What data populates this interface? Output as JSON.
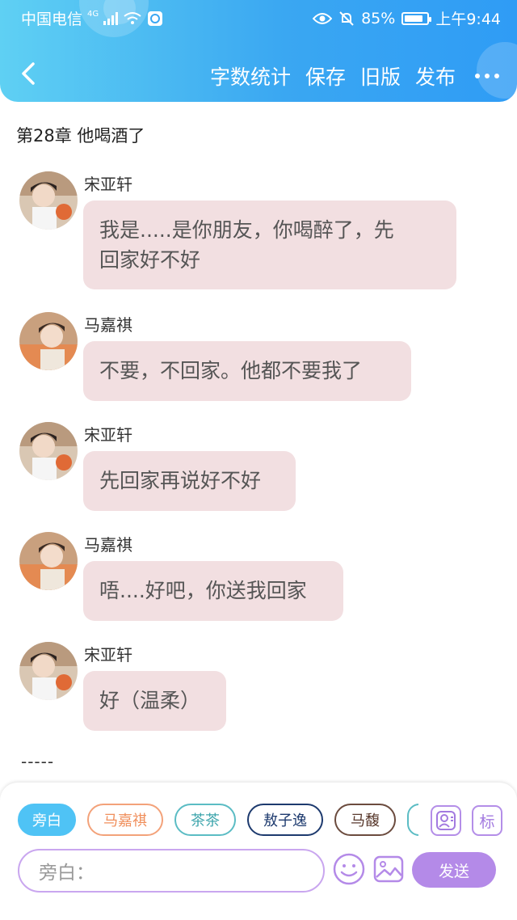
{
  "status_bar": {
    "carrier": "中国电信",
    "network": "4G",
    "battery": "85%",
    "battery_fraction": 0.85,
    "time": "上午9:44"
  },
  "nav": {
    "back_icon": "chevron-left-icon",
    "word_count": "字数统计",
    "save": "保存",
    "old_version": "旧版",
    "publish": "发布",
    "more_icon": "more-dots-icon"
  },
  "chapter_title": "第28章 他喝酒了",
  "messages": [
    {
      "speaker": "宋亚轩",
      "lines": [
        "我是.....是你朋友，你喝醉了，先",
        "回家好不好"
      ],
      "avatar": "song"
    },
    {
      "speaker": "马嘉祺",
      "lines": [
        "不要，不回家。他都不要我了"
      ],
      "avatar": "ma"
    },
    {
      "speaker": "宋亚轩",
      "lines": [
        "先回家再说好不好"
      ],
      "avatar": "song"
    },
    {
      "speaker": "马嘉祺",
      "lines": [
        "唔....好吧，你送我回家"
      ],
      "avatar": "ma"
    },
    {
      "speaker": "宋亚轩",
      "lines": [
        "好（温柔）"
      ],
      "avatar": "song"
    }
  ],
  "divider": "-----",
  "bottom": {
    "chips": [
      "旁白",
      "马嘉祺",
      "茶茶",
      "敖子逸",
      "马馥"
    ],
    "role_icon": "person-card-icon",
    "mark_label": "标",
    "input_placeholder": "旁白：",
    "emoji_icon": "smiley-icon",
    "image_icon": "image-icon",
    "send": "发送"
  },
  "colors": {
    "header_start": "#5fd0f3",
    "header_end": "#2f9cf5",
    "bubble": "#f2dfe1",
    "accent_purple": "#b48ae8"
  }
}
